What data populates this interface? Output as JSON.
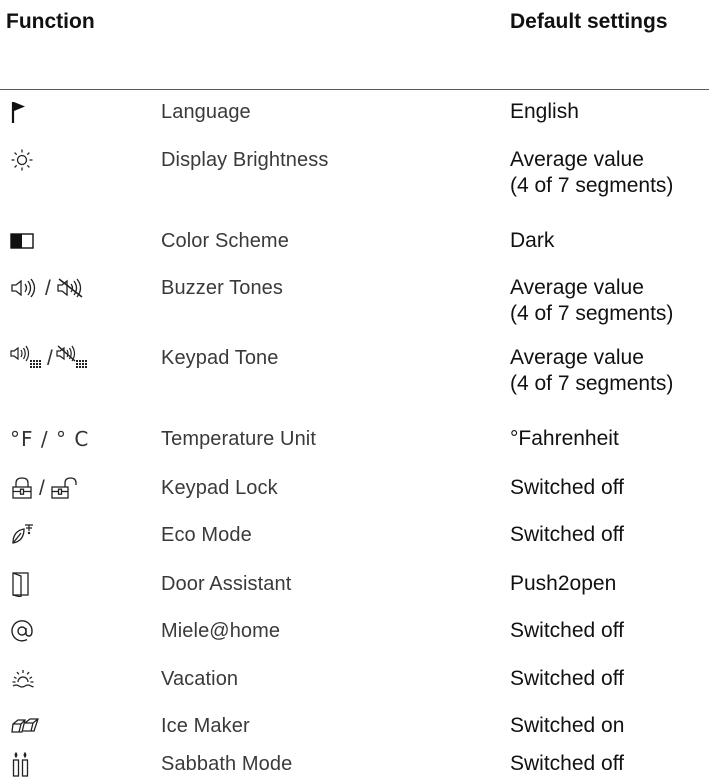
{
  "header": {
    "function_label": "Function",
    "default_label": "Default settings"
  },
  "rows": [
    {
      "icon": "flag-icon",
      "function": "Language",
      "default_line1": "English",
      "default_line2": ""
    },
    {
      "icon": "sun-icon",
      "function": "Display Brightness",
      "default_line1": "Average value",
      "default_line2": "(4 of 7 segments)"
    },
    {
      "icon": "color-scheme-icon",
      "function": "Color Scheme",
      "default_line1": "Dark",
      "default_line2": ""
    },
    {
      "icon": "speaker-icon",
      "function": "Buzzer Tones",
      "default_line1": "Average value",
      "default_line2": "(4 of 7 segments)"
    },
    {
      "icon": "keypad-speaker-icon",
      "function": "Keypad Tone",
      "default_line1": "Average value",
      "default_line2": "(4 of 7 segments)"
    },
    {
      "icon": "temperature-unit-icon",
      "icon_text": "°F / ° C",
      "function": "Temperature Unit",
      "default_line1": "°Fahrenheit",
      "default_line2": ""
    },
    {
      "icon": "lock-icon",
      "function": "Keypad Lock",
      "default_line1": "Switched off",
      "default_line2": ""
    },
    {
      "icon": "eco-leaf-icon",
      "function": "Eco Mode",
      "default_line1": "Switched off",
      "default_line2": ""
    },
    {
      "icon": "door-icon",
      "function": "Door Assistant",
      "default_line1": "Push2open",
      "default_line2": ""
    },
    {
      "icon": "at-icon",
      "function": "Miele@home",
      "default_line1": "Switched off",
      "default_line2": ""
    },
    {
      "icon": "vacation-sun-icon",
      "function": "Vacation",
      "default_line1": "Switched off",
      "default_line2": ""
    },
    {
      "icon": "ice-cubes-icon",
      "function": "Ice Maker",
      "default_line1": "Switched on",
      "default_line2": ""
    },
    {
      "icon": "sabbath-candles-icon",
      "function": "Sabbath Mode",
      "default_line1": "Switched off",
      "default_line2": ""
    }
  ]
}
